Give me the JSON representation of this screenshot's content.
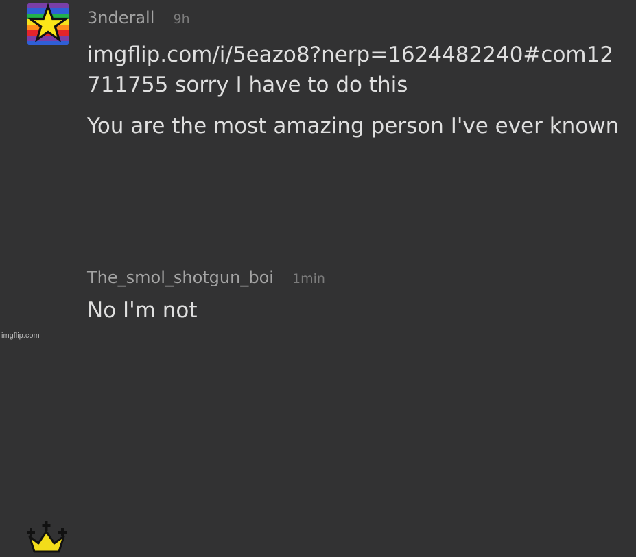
{
  "comments": [
    {
      "username": "3nderall",
      "time": "9h",
      "avatar_icon": "rainbow-star-icon",
      "link_text": "imgflip.com/i/5eazo8?nerp=1624482240#com12711755",
      "text_after_link": " sorry I have to do this",
      "second_paragraph": "You are the most amazing person I've ever known"
    },
    {
      "username": "The_smol_shotgun_boi",
      "time": "1min",
      "avatar_icon": "crown-icon",
      "text": "No I'm not"
    }
  ],
  "watermark": "imgflip.com",
  "colors": {
    "background": "#323233",
    "username": "#a4a4a4",
    "timestamp": "#7c7c7c",
    "body_text": "#dfdfdf",
    "crown": "#f2dc1a",
    "star": "#fbe619"
  }
}
